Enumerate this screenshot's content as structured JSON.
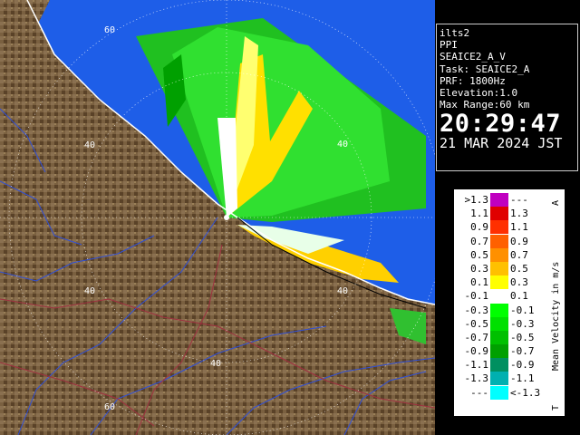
{
  "map": {
    "range_labels": [
      "60",
      "40",
      "40",
      "40",
      "40",
      "60",
      "40"
    ]
  },
  "info": {
    "site": "ilts2",
    "product": "PPI",
    "variable": "SEAICE2_A_V",
    "task": "Task: SEAICE2_A",
    "prf": "PRF: 1800Hz",
    "elevation": "Elevation:1.0",
    "max_range": "Max Range:60 km",
    "time": "20:29:47",
    "date": "21 MAR 2024 JST"
  },
  "legend": {
    "title": "Mean Velocity in m/s",
    "top_marker": "A",
    "bottom_marker": "T",
    "rows": [
      {
        "lo": ">1.3",
        "hi": "---",
        "color": "#c000c0"
      },
      {
        "lo": "1.1",
        "hi": "1.3",
        "color": "#e00000"
      },
      {
        "lo": "0.9",
        "hi": "1.1",
        "color": "#ff3000"
      },
      {
        "lo": "0.7",
        "hi": "0.9",
        "color": "#ff6000"
      },
      {
        "lo": "0.5",
        "hi": "0.7",
        "color": "#ff9000"
      },
      {
        "lo": "0.3",
        "hi": "0.5",
        "color": "#ffc000"
      },
      {
        "lo": "0.1",
        "hi": "0.3",
        "color": "#ffff00"
      },
      {
        "lo": "-0.1",
        "hi": "0.1",
        "color": "#ffffff"
      },
      {
        "lo": "-0.3",
        "hi": "-0.1",
        "color": "#00ff00"
      },
      {
        "lo": "-0.5",
        "hi": "-0.3",
        "color": "#00e000"
      },
      {
        "lo": "-0.7",
        "hi": "-0.5",
        "color": "#00c000"
      },
      {
        "lo": "-0.9",
        "hi": "-0.7",
        "color": "#00a000"
      },
      {
        "lo": "-1.1",
        "hi": "-0.9",
        "color": "#009060"
      },
      {
        "lo": "-1.3",
        "hi": "-1.1",
        "color": "#00b0b0"
      },
      {
        "lo": "---",
        "hi": "<-1.3",
        "color": "#00ffff"
      }
    ]
  },
  "colors": {
    "sea": "#1e5ee8",
    "land": "#7a6040",
    "coast": "#ffffff",
    "river": "#3050d8",
    "road": "#a03040",
    "range_ring": "#ffffff"
  }
}
